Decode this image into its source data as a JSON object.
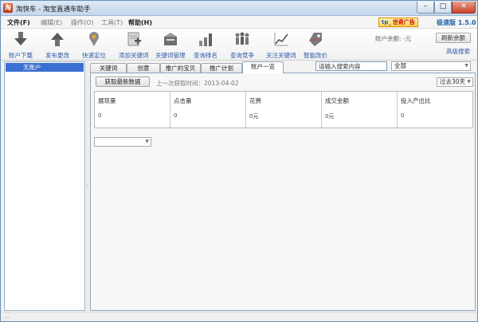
{
  "window": {
    "title": "淘快车 - 淘宝直通车助手",
    "icon_char": "淘",
    "min_glyph": "–",
    "max_glyph": "□",
    "close_glyph": "✕"
  },
  "menu": {
    "items": [
      {
        "label": "文件(F)",
        "style": "bold"
      },
      {
        "label": "编辑(E)",
        "style": "dim"
      },
      {
        "label": "操作(O)",
        "style": "dim"
      },
      {
        "label": "工具(T)",
        "style": "dim"
      },
      {
        "label": "帮助(H)",
        "style": "bold"
      }
    ],
    "ad_badge_prefix": "tp_",
    "ad_badge_text": "世奇广告",
    "version": "极速版 1.5.0"
  },
  "toolbar": {
    "tools": [
      {
        "label": "账户下载",
        "icon": "download-arrow-icon"
      },
      {
        "label": "发布更改",
        "icon": "upload-arrow-icon"
      },
      {
        "label": "快速定位",
        "icon": "location-pin-icon"
      },
      {
        "label": "添加关键词",
        "icon": "add-keyword-icon"
      },
      {
        "label": "关键词管理",
        "icon": "keyword-manage-icon"
      },
      {
        "label": "查询排名",
        "icon": "bar-ranking-icon"
      },
      {
        "label": "查询竞争",
        "icon": "competitors-icon"
      },
      {
        "label": "关注关键词",
        "icon": "trend-line-icon"
      },
      {
        "label": "智能改价",
        "icon": "price-tag-icon"
      }
    ],
    "balance": "账户余额: -元",
    "refresh_label": "刷新余额",
    "advanced_search": "高级搜索"
  },
  "accounts": {
    "selected": "无账户"
  },
  "tabs": [
    {
      "label": "关键词",
      "active": false
    },
    {
      "label": "创意",
      "active": false
    },
    {
      "label": "推广的宝贝",
      "active": false
    },
    {
      "label": "推广计划",
      "active": false
    },
    {
      "label": "账户一览",
      "active": true
    }
  ],
  "search": {
    "value": "请输入搜索内容",
    "scope": "全部"
  },
  "overview": {
    "fetch_label": "获取最新数据",
    "last_fetch": "上一次获取时间：2013-04-02",
    "range": "过去30天",
    "stats": [
      {
        "name": "展现量",
        "value": "0"
      },
      {
        "name": "点击量",
        "value": "0"
      },
      {
        "name": "花费",
        "value": "0元"
      },
      {
        "name": "成交金额",
        "value": "0元"
      },
      {
        "name": "投入产出比",
        "value": "0"
      }
    ],
    "small_select": ""
  },
  "statusbar": {
    "text": "..."
  },
  "colors": {
    "accent": "#3b6fd1",
    "link": "#2d5aa7",
    "version": "#1e62a8"
  }
}
